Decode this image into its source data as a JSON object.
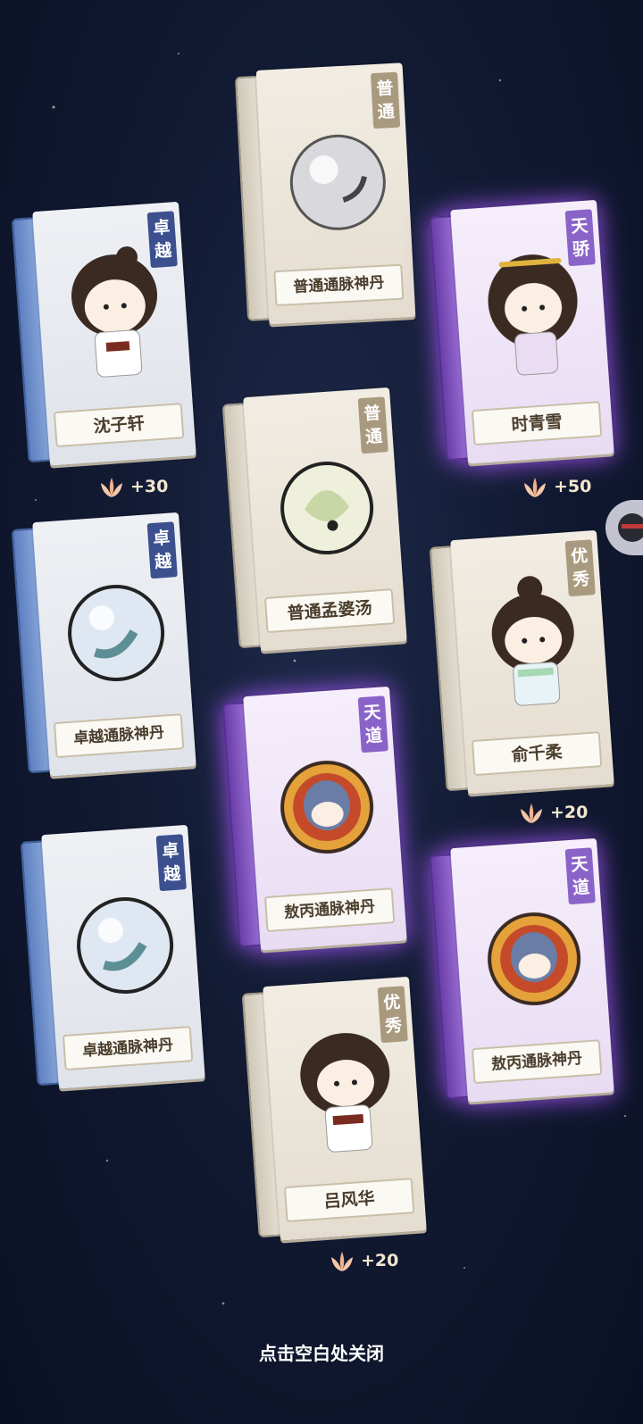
{
  "cards": [
    {
      "name": "沈子轩",
      "rarity_chars": [
        "卓",
        "越"
      ],
      "kind": "character"
    },
    {
      "name": "普通通脉神丹",
      "rarity_chars": [
        "普",
        "通"
      ],
      "kind": "pill"
    },
    {
      "name": "时青雪",
      "rarity_chars": [
        "天",
        "骄"
      ],
      "kind": "character"
    },
    {
      "name": "普通孟婆汤",
      "rarity_chars": [
        "普",
        "通"
      ],
      "kind": "soup"
    },
    {
      "name": "卓越通脉神丹",
      "rarity_chars": [
        "卓",
        "越"
      ],
      "kind": "pill"
    },
    {
      "name": "俞千柔",
      "rarity_chars": [
        "优",
        "秀"
      ],
      "kind": "character"
    },
    {
      "name": "敖丙通脉神丹",
      "rarity_chars": [
        "天",
        "道"
      ],
      "kind": "pill"
    },
    {
      "name": "卓越通脉神丹",
      "rarity_chars": [
        "卓",
        "越"
      ],
      "kind": "pill"
    },
    {
      "name": "敖丙通脉神丹",
      "rarity_chars": [
        "天",
        "道"
      ],
      "kind": "pill"
    },
    {
      "name": "吕风华",
      "rarity_chars": [
        "优",
        "秀"
      ],
      "kind": "character"
    }
  ],
  "rewards": [
    "+30",
    "+50",
    "+20",
    "+20"
  ],
  "close_hint": "点击空白处关闭",
  "colors": {
    "tier_zhuo": "#3c4f8e",
    "tier_tian": "#8a63c9",
    "tier_common": "#a99a7f"
  }
}
